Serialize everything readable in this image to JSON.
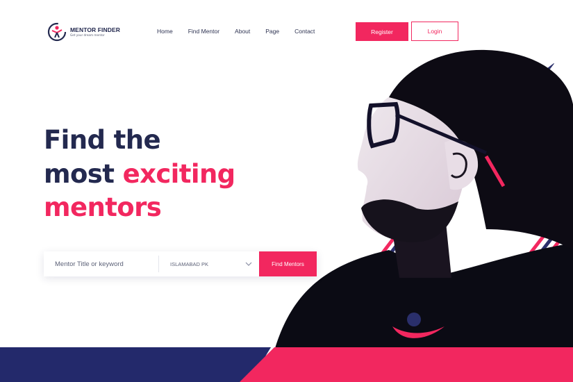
{
  "brand": {
    "name": "MENTOR FINDER",
    "tagline": "Get your dream mentor"
  },
  "nav": {
    "items": [
      {
        "label": "Home"
      },
      {
        "label": "Find Mentor"
      },
      {
        "label": "About"
      },
      {
        "label": "Page"
      },
      {
        "label": "Contact"
      }
    ]
  },
  "auth": {
    "register_label": "Register",
    "login_label": "Login"
  },
  "hero": {
    "line1": "Find the",
    "line2a": "most",
    "line2b": "exciting",
    "line3": "mentors"
  },
  "search": {
    "placeholder": "Mentor Title or keyword",
    "location_value": "ISLAMABAD PK",
    "button_label": "Find Mentors"
  },
  "colors": {
    "accent": "#f2275f",
    "navy": "#23294f",
    "text": "#2e3352"
  },
  "icons": {
    "logo": "mentor-finder-logo-icon",
    "location_dropdown": "chevron-down-icon"
  }
}
